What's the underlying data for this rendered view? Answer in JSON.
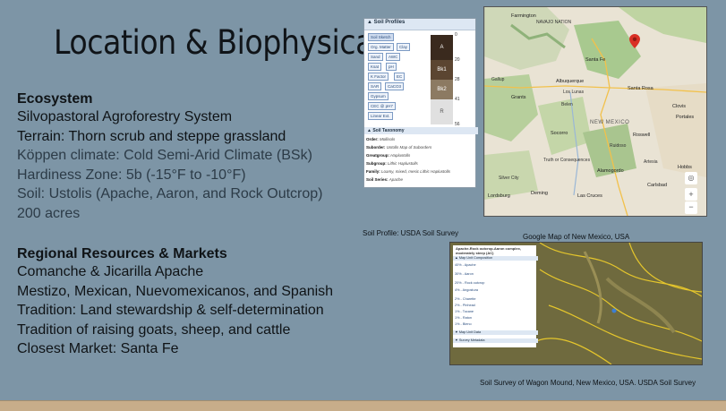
{
  "title": "Location & Biophysical",
  "ecosystem": {
    "heading": "Ecosystem",
    "lines": [
      "Silvopastoral Agroforestry System",
      "Terrain: Thorn scrub and steppe grassland",
      "Köppen climate: Cold Semi-Arid Climate (BSk)",
      "Hardiness Zone: 5b (-15°F to -10°F)",
      "Soil: Ustolis (Apache, Aaron, and Rock Outcrop)",
      "200 acres"
    ]
  },
  "regional": {
    "heading": "Regional Resources & Markets",
    "lines": [
      "Comanche & Jicarilla Apache",
      "Mestizo, Mexican, Nuevomexicanos, and Spanish",
      "Tradition: Land stewardship & self-determination",
      "Tradition of raising goats, sheep, and cattle",
      "Closest Market: Santa Fe"
    ]
  },
  "captions": {
    "soil_profile": "Soil Profile: USDA  Soil Survey",
    "google_map": "Google Map of New Mexico, USA",
    "soil_survey": "Soil Survey of Wagon Mound, New Mexico, USA. USDA Soil Survey"
  },
  "soil_profile": {
    "header": "Soil Profiles",
    "buttons": [
      "Soil Sketch",
      "Org. Matter",
      "Clay",
      "Sand",
      "AWC",
      "Ksat",
      "pH",
      "K Factor",
      "EC",
      "SAR",
      "CaCO3",
      "Gypsum",
      "CEC @ pH7",
      "Linear Ext."
    ],
    "horizons": [
      "A",
      "Bk1",
      "Bk2",
      "R"
    ],
    "depths": [
      "0",
      "20",
      "28",
      "41",
      "56"
    ],
    "taxonomy_header": "Soil Taxonomy",
    "taxonomy": [
      {
        "label": "Order:",
        "value": "Mollisols"
      },
      {
        "label": "Suborder:",
        "value": "Ustolls  Map of Suborders"
      },
      {
        "label": "Greatgroup:",
        "value": "Haplustolls"
      },
      {
        "label": "Subgroup:",
        "value": "Lithic Haplustolls"
      },
      {
        "label": "Family:",
        "value": "Loamy, mixed, mesic Lithic Haplustolls"
      },
      {
        "label": "Soil Series:",
        "value": "Apache"
      }
    ]
  },
  "map": {
    "state_label": "NEW MEXICO",
    "cities": [
      "Farmington",
      "Santa Fe",
      "Albuquerque",
      "Grants",
      "Santa Rosa",
      "Clovis",
      "Roswell",
      "Las Cruces",
      "Deming",
      "Lordsburg",
      "Alamogordo",
      "Carlsbad",
      "Hobbs",
      "Socorro",
      "Portales"
    ],
    "small_labels": [
      "NAVAJO NATION",
      "Gallup",
      "Los Lunas",
      "Belen",
      "Ruidoso",
      "Truth or Consequences",
      "Artesia",
      "Silver City"
    ]
  },
  "survey": {
    "title": "Apache-Rock outcrop-Aaron complex, moderately steep (AC)",
    "sections": [
      "Map Unit Composition",
      "Map Unit Data",
      "Survey Metadata"
    ],
    "rows": [
      "40% - Apache",
      "30% - Aaron",
      "20% - Rock outcrop",
      "4% - Angostura",
      "2% - Charette",
      "2% - Pinhead",
      "1% - Tocane",
      "1% - Raton",
      "1% - Bieno"
    ]
  }
}
